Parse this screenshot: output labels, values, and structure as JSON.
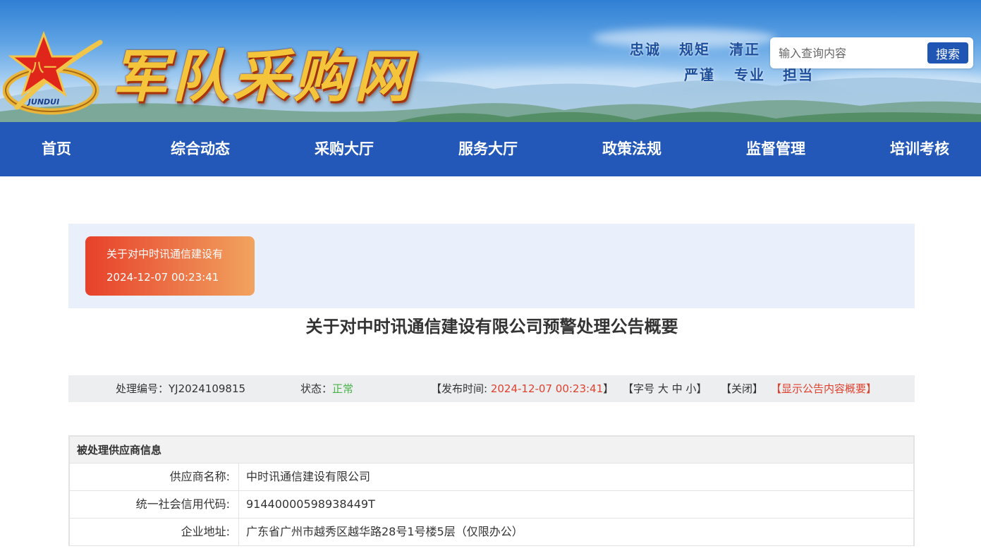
{
  "header": {
    "site_title": "军队采购网",
    "logo_text": "JUNDUI",
    "motto_row1": [
      "忠诚",
      "规矩",
      "清正"
    ],
    "motto_row2": [
      "严谨",
      "专业",
      "担当"
    ]
  },
  "search": {
    "placeholder": "输入查询内容",
    "button_label": "搜索"
  },
  "nav": {
    "items": [
      "首页",
      "综合动态",
      "采购大厅",
      "服务大厅",
      "政策法规",
      "监督管理",
      "培训考核"
    ]
  },
  "notice_card": {
    "title": "关于对中时讯通信建设有",
    "datetime": "2024-12-07 00:23:41"
  },
  "article": {
    "title": "关于对中时讯通信建设有限公司预警处理公告概要",
    "meta": {
      "number_label": "处理编号：",
      "number_value": "YJ2024109815",
      "status_label": "状态：",
      "status_value": "正常",
      "publish_prefix": "【发布时间: ",
      "publish_time": "2024-12-07 00:23:41",
      "publish_suffix": "】",
      "font_size_prefix": "【字号",
      "font_large": "大",
      "font_medium": "中",
      "font_small": "小",
      "font_size_suffix": "】",
      "close_label": "【关闭】",
      "summary_label": "【显示公告内容概要】"
    }
  },
  "supplier_table": {
    "heading": "被处理供应商信息",
    "rows": [
      {
        "label": "供应商名称:",
        "value": "中时讯通信建设有限公司"
      },
      {
        "label": "统一社会信用代码:",
        "value": "91440000598938449T"
      },
      {
        "label": "企业地址:",
        "value": "广东省广州市越秀区越华路28号1号楼5层（仅限办公）"
      }
    ]
  },
  "colors": {
    "nav_bg": "#2358b8",
    "search_button": "#1f55b3",
    "status_green": "#4bb34b",
    "highlight_red": "#e0412e",
    "notice_card_start": "#e8412a",
    "notice_card_end": "#f2a35f",
    "notice_panel_bg": "#e9f0fc"
  }
}
